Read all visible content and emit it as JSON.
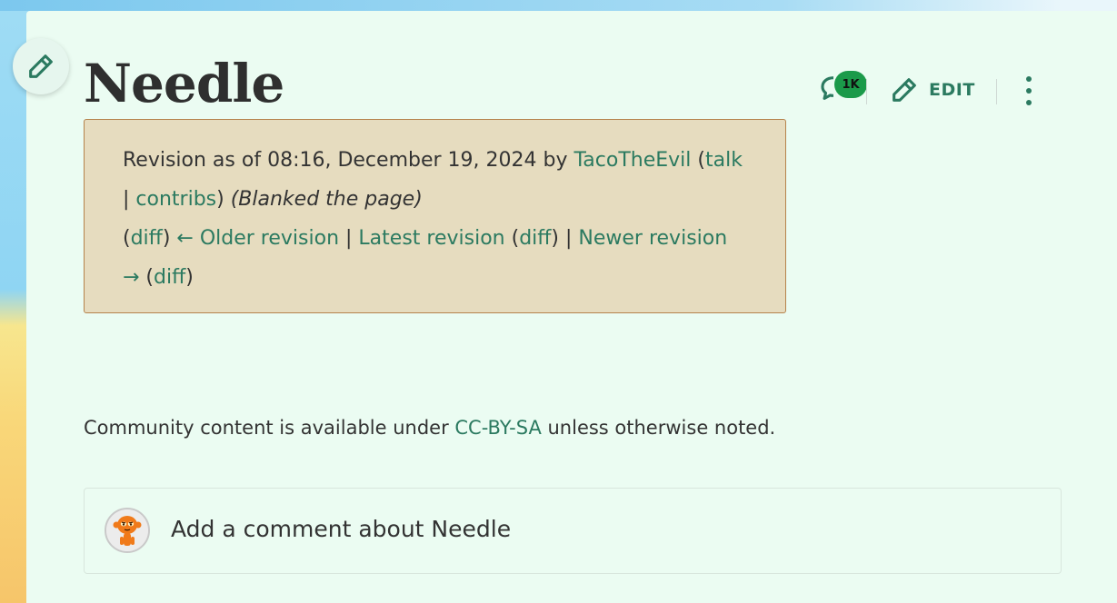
{
  "page": {
    "title": "Needle"
  },
  "actions": {
    "talk_count": "1K",
    "edit_label": "EDIT"
  },
  "revision": {
    "prefix": "Revision as of 08:16, December 19, 2024 by ",
    "user": "TacoTheEvil",
    "open_paren": " (",
    "talk": "talk",
    "pipe1": "| ",
    "contribs": "contribs",
    "close_paren": ") ",
    "summary": "(Blanked the page)",
    "nav": {
      "p1": "(",
      "diff1": "diff",
      "p2": ") ",
      "older": "← Older revision",
      "sep1": " | ",
      "latest": "Latest revision",
      "p3": " (",
      "diff2": "diff",
      "p4": ") | ",
      "newer": "Newer revision →",
      "p5": " (",
      "diff3": "diff",
      "p6": ")"
    }
  },
  "license": {
    "before": "Community content is available under ",
    "link": "CC-BY-SA",
    "after": " unless otherwise noted."
  },
  "comment": {
    "placeholder": "Add a comment about Needle"
  },
  "colors": {
    "accent": "#2b7a60",
    "badge": "#1b9a4a",
    "page_bg": "#ebfcf2",
    "revision_bg": "#e6dcbf"
  }
}
